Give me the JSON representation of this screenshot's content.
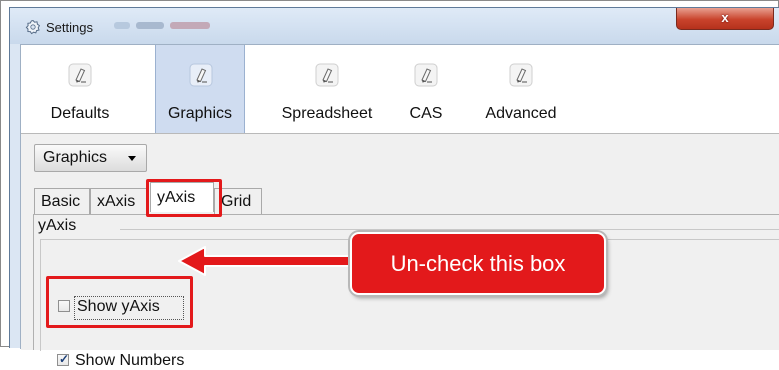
{
  "window": {
    "title": "Settings",
    "close_symbol": "x"
  },
  "toolbar": {
    "items": [
      {
        "label": "Defaults",
        "icon": "pencil-eraser-icon",
        "selected": false
      },
      {
        "label": "Graphics",
        "icon": "pencil-eraser-icon",
        "selected": true
      },
      {
        "label": "Spreadsheet",
        "icon": "pencil-eraser-icon",
        "selected": false
      },
      {
        "label": "CAS",
        "icon": "pencil-eraser-icon",
        "selected": false
      },
      {
        "label": "Advanced",
        "icon": "pencil-eraser-icon",
        "selected": false
      }
    ]
  },
  "view_select": {
    "value": "Graphics"
  },
  "tabs": [
    "Basic",
    "xAxis",
    "yAxis",
    "Grid"
  ],
  "active_tab": "yAxis",
  "group": {
    "title": "yAxis"
  },
  "options": {
    "show_yaxis": {
      "label": "Show yAxis",
      "checked": false
    },
    "show_numbers": {
      "label": "Show Numbers",
      "checked": true
    }
  },
  "annotation": {
    "callout": "Un-check this box"
  },
  "colors": {
    "annotation_red": "#e3191b",
    "selected_tab_bg": "#cfdcf0",
    "titlebar": "#c9d9ec"
  }
}
